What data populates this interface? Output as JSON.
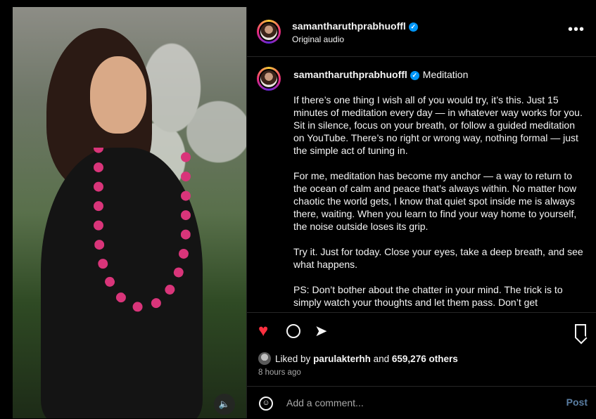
{
  "post": {
    "username": "samantharuthprabhuoffl",
    "verified_glyph": "✓",
    "audio_label": "Original audio",
    "more_icon_glyph": "•••",
    "sound_icon_glyph": "🔈"
  },
  "caption": {
    "username": "samantharuthprabhuoffl",
    "title": "Meditation",
    "paragraphs": [
      "If there’s one thing I wish all of you would try, it’s this. Just 15 minutes of meditation every day — in whatever way works for you. Sit in silence, focus on your breath, or follow a guided meditation on YouTube. There’s no right or wrong way, nothing formal — just the simple act of tuning in.",
      "For me, meditation has become my anchor — a way to return to the ocean of calm and peace that’s always within. No matter how chaotic the world gets, I know that quiet spot inside me is always there, waiting. When you learn to find your way home to yourself, the noise outside loses its grip.",
      "Try it. Just for today. Close your eyes, take a deep breath, and see what happens.",
      "PS: Don’t bother about the chatter in your mind. The trick is to simply watch your thoughts and let them pass. Don’t get"
    ]
  },
  "actions": {
    "liked": true,
    "heart_glyph": "♥",
    "share_glyph": "➤",
    "liked_by_prefix": "Liked by",
    "liked_by_user": "parulakterhh",
    "liked_by_and": "and",
    "others_count": "659,276 others",
    "timestamp": "8 hours ago"
  },
  "comment": {
    "placeholder": "Add a comment...",
    "post_label": "Post",
    "emoji_glyph": "☺"
  },
  "colors": {
    "background": "#000000",
    "heart_active": "#ff3040",
    "verified_blue": "#0095f6",
    "post_button_disabled": "#5a7ea3",
    "muted_text": "#a8a8a8"
  }
}
